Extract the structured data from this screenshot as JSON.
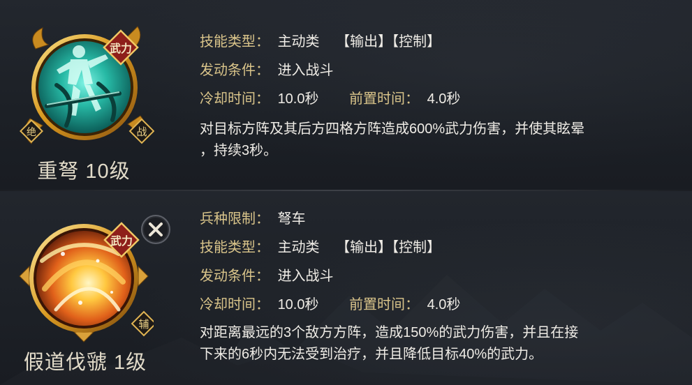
{
  "skills": [
    {
      "name": "重弩 10级",
      "badge_type": "武力",
      "badge_left": "绝",
      "badge_right": "战",
      "rows": [
        {
          "label": "技能类型",
          "value": "主动类",
          "tags": [
            "【输出】",
            "【控制】"
          ]
        },
        {
          "label": "发动条件",
          "value": "进入战斗"
        }
      ],
      "cooldown": {
        "label": "冷却时间",
        "value": "10.0秒",
        "label2": "前置时间",
        "value2": "4.0秒"
      },
      "description": [
        "对目标方阵及其后方四格方阵造成600%武力伤害，并使其眩晕",
        "，持续3秒。"
      ]
    },
    {
      "name": "假道伐虢 1级",
      "badge_type": "武力",
      "badge_right": "辅",
      "rows": [
        {
          "label": "兵种限制",
          "value": "弩车"
        },
        {
          "label": "技能类型",
          "value": "主动类",
          "tags": [
            "【输出】",
            "【控制】"
          ]
        },
        {
          "label": "发动条件",
          "value": "进入战斗"
        }
      ],
      "cooldown": {
        "label": "冷却时间",
        "value": "10.0秒",
        "label2": "前置时间",
        "value2": "4.0秒"
      },
      "description": [
        "对距离最远的3个敌方方阵，造成150%的武力伤害，并且在接",
        "下来的6秒内无法受到治疗，并且降低目标40%的武力。"
      ]
    }
  ],
  "separator": "：",
  "close_icon": "close-x-icon",
  "colors": {
    "label": "#d9c48a",
    "value": "#efece6",
    "name": "#e2dbc9",
    "gold_frame": "#e0a531",
    "badge_red": "#8e1f1a",
    "badge_dark": "#1e1a16"
  }
}
